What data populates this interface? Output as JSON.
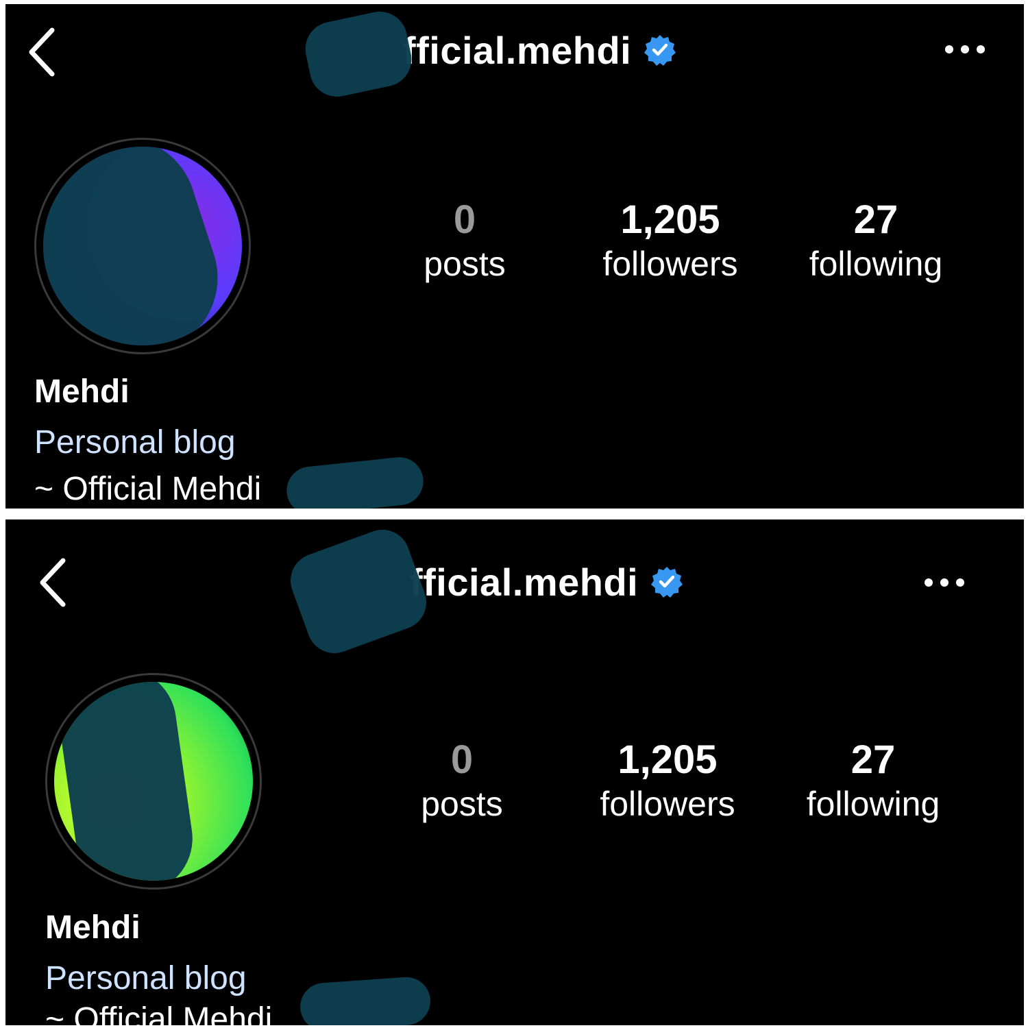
{
  "colors": {
    "background": "#000000",
    "verified_badge": "#3897f0",
    "category_text": "#cfe2ff",
    "posts_count": "#9a9a9a"
  },
  "icons": {
    "back": "chevron-left-icon",
    "more": "more-horizontal-icon",
    "verified": "verified-badge-icon"
  },
  "screens": [
    {
      "header": {
        "username": "fficial.mehdi"
      },
      "stats": [
        {
          "value": "0",
          "label": "posts"
        },
        {
          "value": "1,205",
          "label": "followers"
        },
        {
          "value": "27",
          "label": "following"
        }
      ],
      "profile": {
        "display_name": "Mehdi",
        "category": "Personal blog",
        "bio": "~ Official Mehdi"
      },
      "avatar_colors": [
        "#3b5bff",
        "#8a2be2"
      ]
    },
    {
      "header": {
        "username": "fficial.mehdi"
      },
      "stats": [
        {
          "value": "0",
          "label": "posts"
        },
        {
          "value": "1,205",
          "label": "followers"
        },
        {
          "value": "27",
          "label": "following"
        }
      ],
      "profile": {
        "display_name": "Mehdi",
        "category": "Personal blog",
        "bio": "~ Official Mehdi"
      },
      "avatar_colors": [
        "#c8ff2e",
        "#2ee05a"
      ]
    }
  ]
}
